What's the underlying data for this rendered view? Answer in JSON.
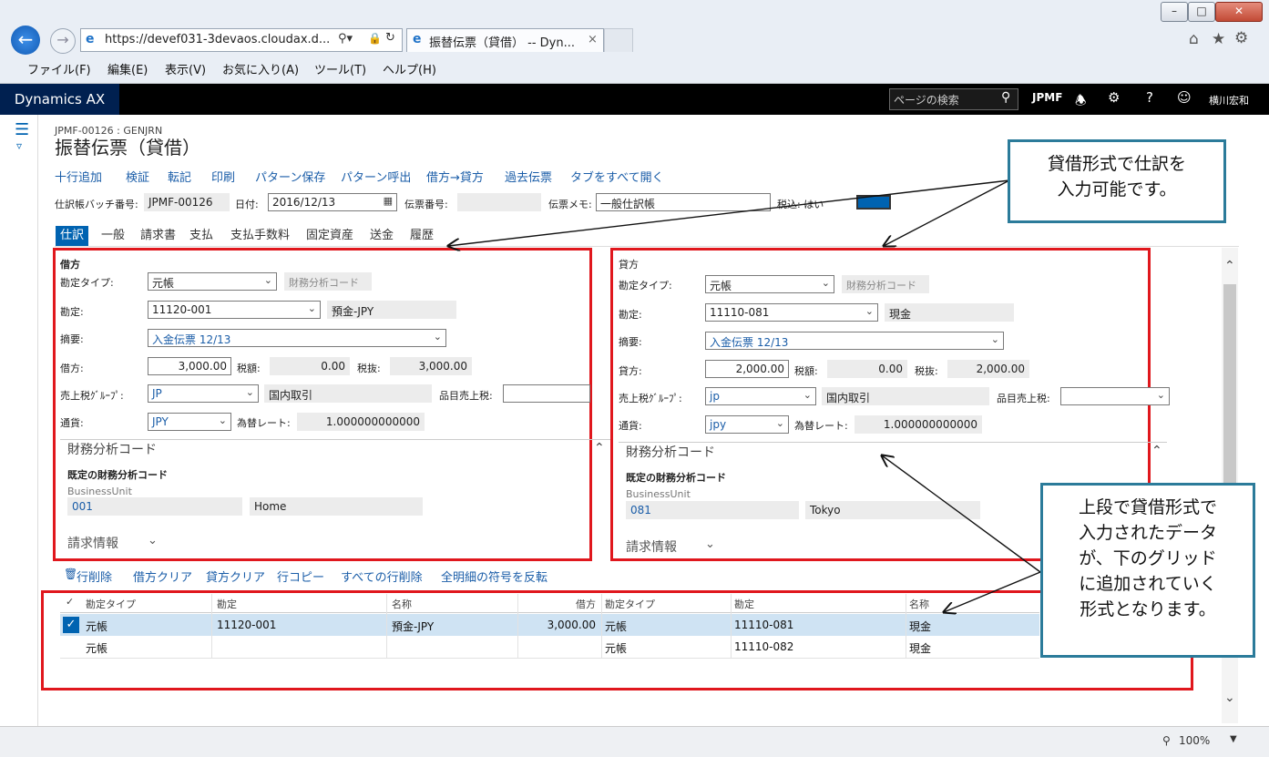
{
  "browser": {
    "url": "https://devef031-3devaos.cloudax.d...",
    "tab_title": "振替伝票（貸借） -- Dyn...",
    "menu": [
      "ファイル(F)",
      "編集(E)",
      "表示(V)",
      "お気に入り(A)",
      "ツール(T)",
      "ヘルプ(H)"
    ],
    "zoom": "100%"
  },
  "app": {
    "brand": "Dynamics AX",
    "search_placeholder": "ページの検索",
    "company": "JPMF",
    "user": "横川宏和"
  },
  "page": {
    "breadcrumb": "JPMF-00126 : GENJRN",
    "title": "振替伝票（貸借）",
    "actions": [
      "十行追加",
      "検証",
      "転記",
      "印刷",
      "パターン保存",
      "パターン呼出",
      "借方→貸方",
      "過去伝票",
      "タブをすべて開く"
    ]
  },
  "header": {
    "batch_label": "仕訳帳バッチ番号:",
    "batch_value": "JPMF-00126",
    "date_label": "日付:",
    "date_value": "2016/12/13",
    "voucher_label": "伝票番号:",
    "memo_label": "伝票メモ:",
    "memo_value": "一般仕訳帳",
    "tax_incl_label": "税込: はい"
  },
  "tabs": [
    "仕訳",
    "一般",
    "請求書",
    "支払",
    "支払手数料",
    "固定資産",
    "送金",
    "履歴"
  ],
  "debit": {
    "section_title": "借方",
    "account_type_label": "勘定タイプ:",
    "account_type": "元帳",
    "fin_dim_button": "財務分析コード",
    "account_label": "勘定:",
    "account": "11120-001",
    "account_name": "預金-JPY",
    "desc_label": "摘要:",
    "desc": "入金伝票 12/13",
    "amount_label": "借方:",
    "amount": "3,000.00",
    "tax_label": "税額:",
    "tax": "0.00",
    "excl_label": "税抜:",
    "excl": "3,000.00",
    "sales_tax_group_label": "売上税ｸﾞﾙｰﾌﾟ:",
    "sales_tax_group": "JP",
    "sales_tax_group_name": "国内取引",
    "item_tax_label": "品目売上税:",
    "currency_label": "通貨:",
    "currency": "JPY",
    "rate_label": "為替レート:",
    "rate": "1.000000000000",
    "fd_header": "財務分析コード",
    "fd_default": "既定の財務分析コード",
    "bu_label": "BusinessUnit",
    "bu_code": "001",
    "bu_name": "Home",
    "billing": "請求情報"
  },
  "credit": {
    "section_title": "貸方",
    "account_type_label": "勘定タイプ:",
    "account_type": "元帳",
    "fin_dim_button": "財務分析コード",
    "account_label": "勘定:",
    "account": "11110-081",
    "account_name": "現金",
    "desc_label": "摘要:",
    "desc": "入金伝票 12/13",
    "amount_label": "貸方:",
    "amount": "2,000.00",
    "tax_label": "税額:",
    "tax": "0.00",
    "excl_label": "税抜:",
    "excl": "2,000.00",
    "sales_tax_group_label": "売上税ｸﾞﾙｰﾌﾟ:",
    "sales_tax_group": "jp",
    "sales_tax_group_name": "国内取引",
    "item_tax_label": "品目売上税:",
    "currency_label": "通貨:",
    "currency": "jpy",
    "rate_label": "為替レート:",
    "rate": "1.000000000000",
    "fd_header": "財務分析コード",
    "fd_default": "既定の財務分析コード",
    "bu_label": "BusinessUnit",
    "bu_code": "081",
    "bu_name": "Tokyo",
    "billing": "請求情報"
  },
  "grid_actions": [
    "行削除",
    "借方クリア",
    "貸方クリア",
    "行コピー",
    "すべての行削除",
    "全明細の符号を反転"
  ],
  "grid": {
    "headers": [
      "勘定タイプ",
      "勘定",
      "名称",
      "借方",
      "勘定タイプ",
      "勘定",
      "名称"
    ],
    "rows": [
      [
        "元帳",
        "11120-001",
        "預金-JPY",
        "3,000.00",
        "元帳",
        "11110-081",
        "現金"
      ],
      [
        "元帳",
        "",
        "",
        "",
        "元帳",
        "11110-082",
        "現金"
      ]
    ]
  },
  "callouts": {
    "top": "貸借形式で仕訳を\n入力可能です。",
    "bottom": "上段で貸借形式で\n入力されたデータ\nが、下のグリッド\nに追加されていく\n形式となります。"
  },
  "colors": {
    "accent": "#0063b1",
    "annotation_red": "#e0171d",
    "callout_border": "#2b7b9a"
  }
}
